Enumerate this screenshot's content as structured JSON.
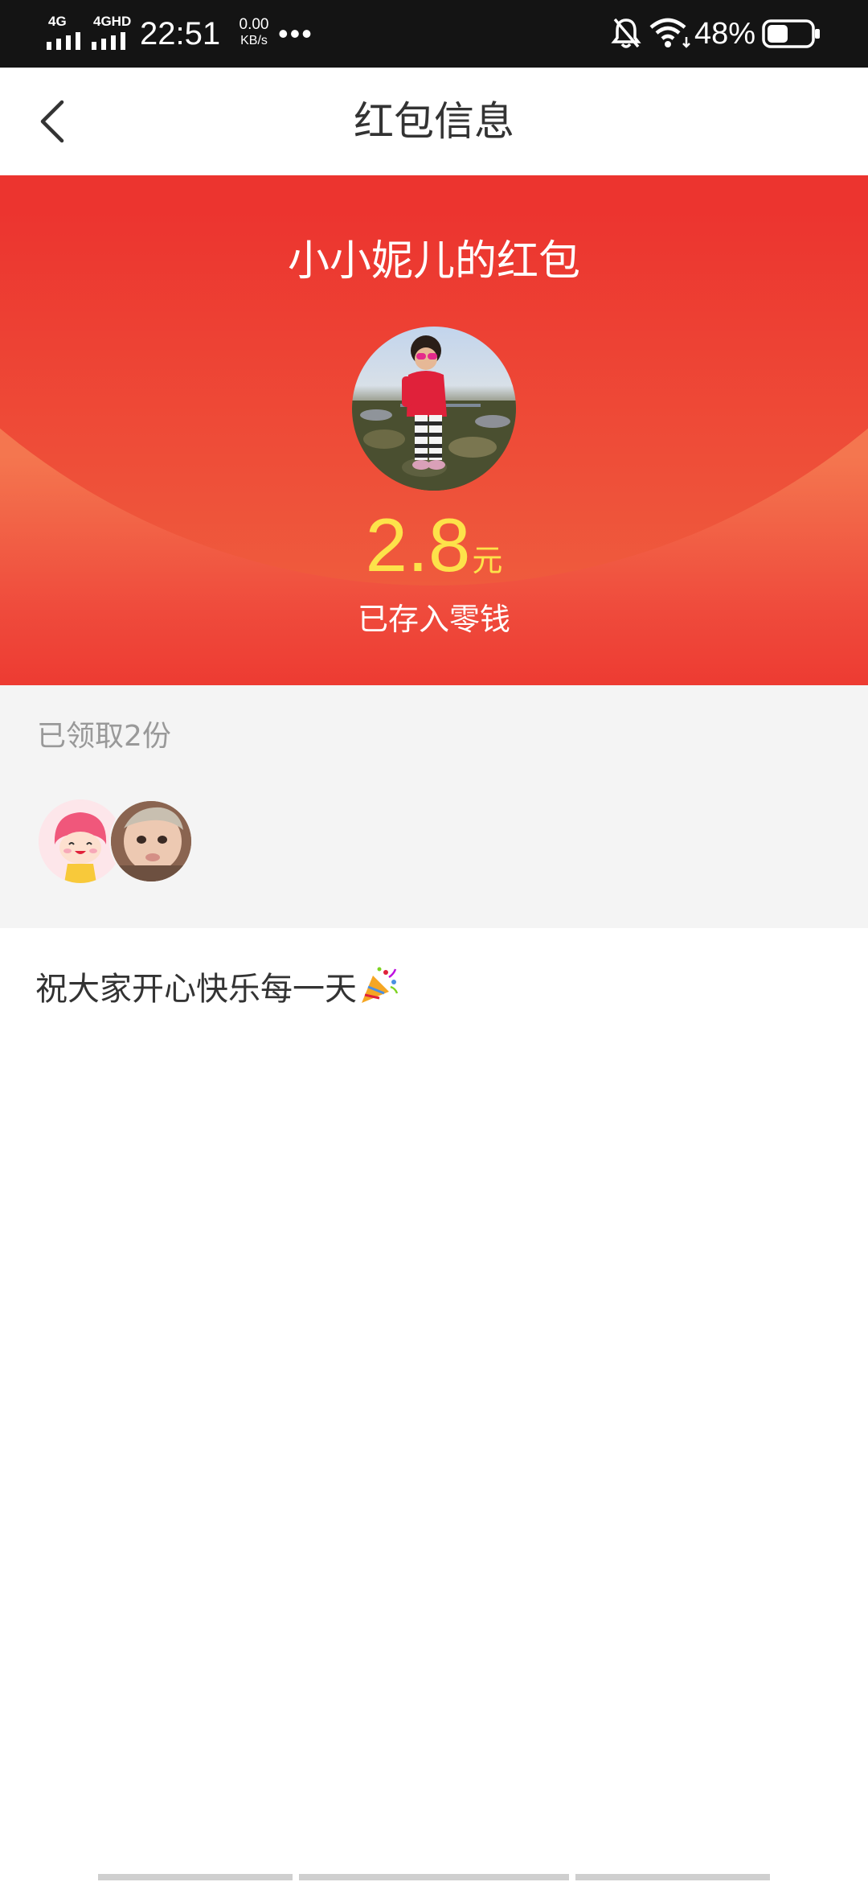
{
  "status_bar": {
    "sim1_label": "4G",
    "sim2_label": "4GHD",
    "time": "22:51",
    "speed_value": "0.00",
    "speed_unit": "KB/s",
    "overflow_dots": "•••",
    "battery_percent": "48%",
    "battery_level": 0.48
  },
  "header": {
    "title": "红包信息"
  },
  "red_packet": {
    "sender_title": "小小妮儿的红包",
    "amount": "2.8",
    "unit": "元",
    "deposit_text": "已存入零钱"
  },
  "claimed": {
    "count_text": "已领取2份"
  },
  "message": {
    "text": "祝大家开心快乐每一天"
  },
  "colors": {
    "accent_red": "#ec342f",
    "amount_yellow": "#fde24a",
    "status_bar_bg": "#141414"
  },
  "icons": [
    "back-arrow-icon",
    "party-popper-icon",
    "mute-bell-icon",
    "wifi-icon",
    "battery-icon",
    "signal-icon"
  ]
}
